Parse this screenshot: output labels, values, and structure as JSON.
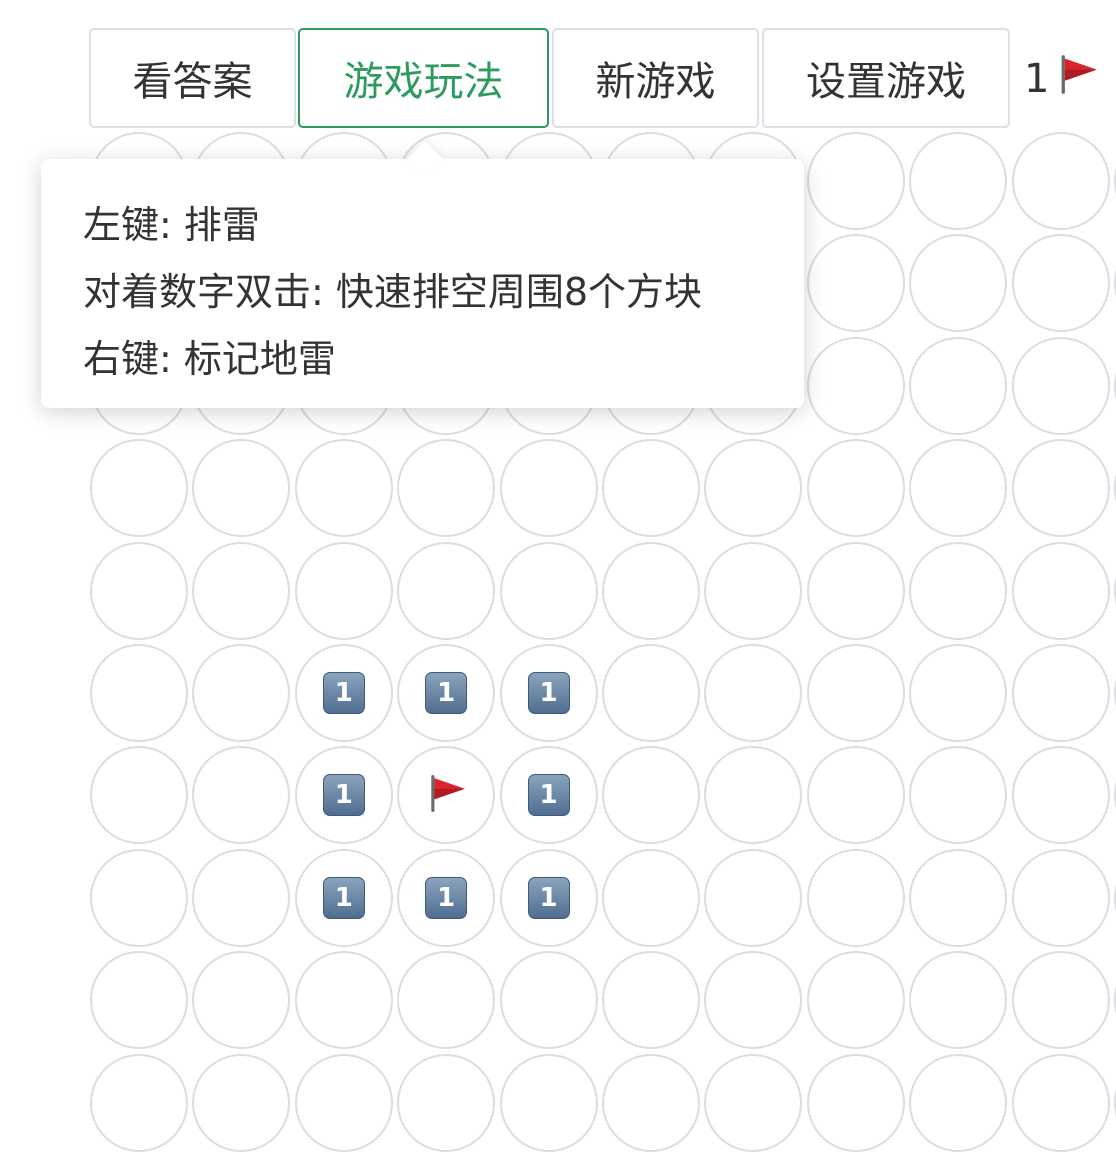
{
  "toolbar": {
    "show_answer_label": "看答案",
    "how_to_play_label": "游戏玩法",
    "new_game_label": "新游戏",
    "settings_label": "设置游戏",
    "active_color": "#2e9b5e"
  },
  "flag_counter": {
    "count": "1",
    "icon": "triangular-flag-icon"
  },
  "help_popover": {
    "lines": [
      "左键: 排雷",
      "对着数字双击: 快速排空周围8个方块",
      "右键: 标记地雷"
    ]
  },
  "board": {
    "visible_rows": 10,
    "visible_cols": 11,
    "revealed_cells": [
      {
        "row": 5,
        "col": 2,
        "content": "1",
        "type": "number"
      },
      {
        "row": 5,
        "col": 3,
        "content": "1",
        "type": "number"
      },
      {
        "row": 5,
        "col": 4,
        "content": "1",
        "type": "number"
      },
      {
        "row": 6,
        "col": 2,
        "content": "1",
        "type": "number"
      },
      {
        "row": 6,
        "col": 3,
        "content": "flag",
        "type": "flag"
      },
      {
        "row": 6,
        "col": 4,
        "content": "1",
        "type": "number"
      },
      {
        "row": 7,
        "col": 2,
        "content": "1",
        "type": "number"
      },
      {
        "row": 7,
        "col": 3,
        "content": "1",
        "type": "number"
      },
      {
        "row": 7,
        "col": 4,
        "content": "1",
        "type": "number"
      }
    ],
    "number_badge_color": "#5b7a9c",
    "cell_border_color": "#dcdce2"
  }
}
